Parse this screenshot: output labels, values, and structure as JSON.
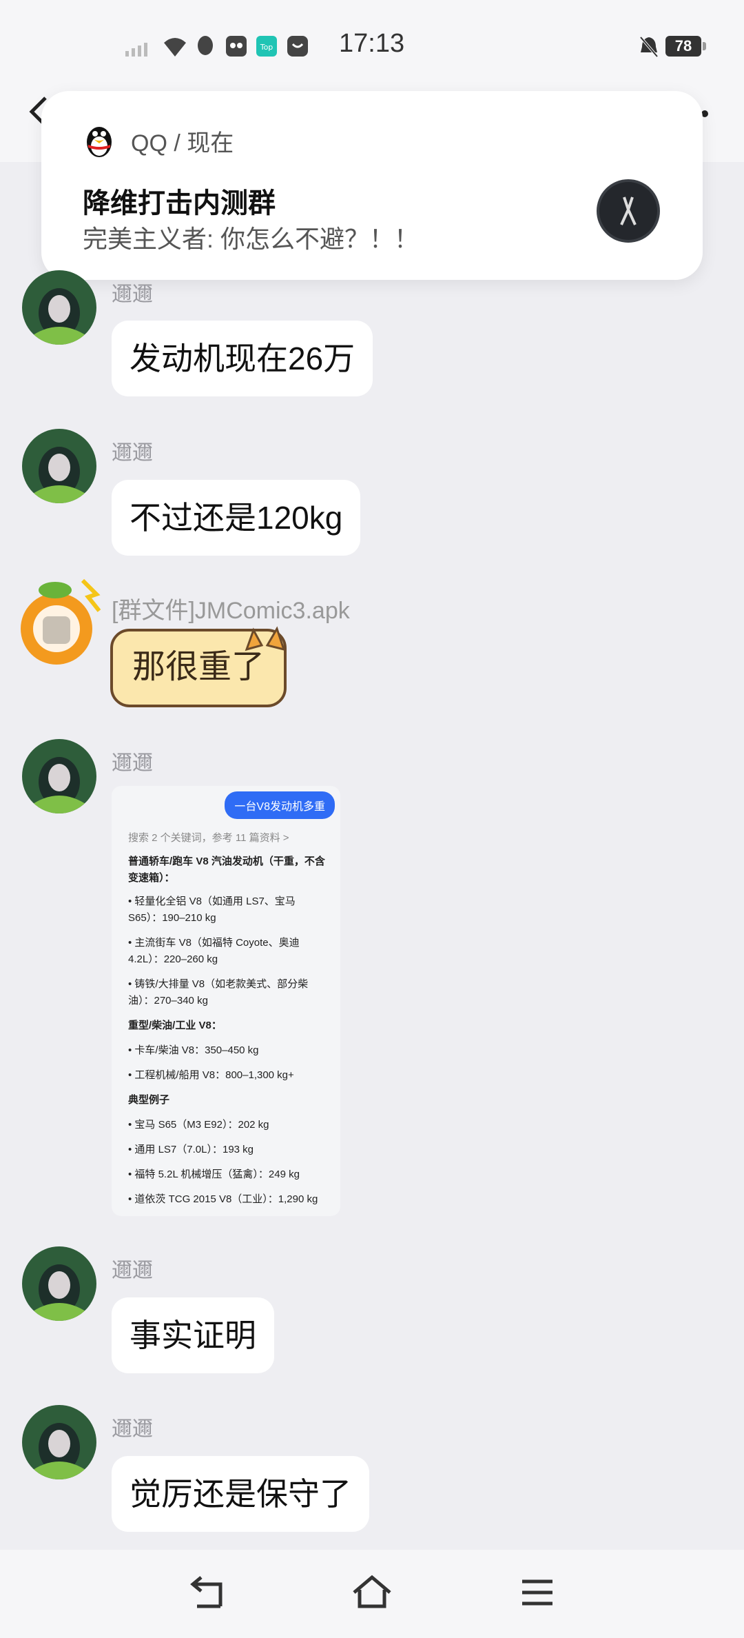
{
  "status_bar": {
    "time": "17:13",
    "battery": "78",
    "icons": [
      "signal-icon",
      "wifi-icon",
      "qq-icon",
      "app-icon",
      "top-app-icon",
      "message-app-icon",
      "mute-bell-icon",
      "battery-icon"
    ]
  },
  "notification": {
    "app": "QQ / 现在",
    "title": "降维打击内测群",
    "body": "完美主义者: 你怎么不避？！！"
  },
  "messages": [
    {
      "sender": "邇邇",
      "text": "发动机现在26万"
    },
    {
      "sender": "邇邇",
      "text": "不过还是120kg"
    },
    {
      "file": "[群文件]JMComic3.apk",
      "text": "那很重了"
    },
    {
      "sender": "邇邇"
    },
    {
      "sender": "邇邇",
      "text": "事实证明"
    },
    {
      "sender": "邇邇",
      "text": "觉厉还是保守了"
    }
  ],
  "image_message": {
    "query": "一台V8发动机多重",
    "lines": [
      "搜索 2 个关键词，参考 11 篇资料 >",
      "普通轿车/跑车 V8 汽油发动机（干重，不含",
      "变速箱）：",
      "• 轻量化全铝 V8（如通用 LS7、宝马",
      "  S65）：190–210 kg",
      "• 主流街车 V8（如福特 Coyote、奥迪",
      "  4.2L）：220–260 kg",
      "• 铸铁/大排量 V8（如老款美式、部分柴",
      "  油）：270–340 kg",
      "重型/柴油/工业 V8：",
      "• 卡车/柴油 V8：350–450 kg",
      "• 工程机械/船用 V8：800–1,300 kg+",
      "典型例子",
      "• 宝马 S65（M3 E92）：202 kg",
      "• 通用 LS7（7.0L）：193 kg",
      "• 福特 5.2L 机械增压（猛禽）：249 kg",
      "• 道依茨 TCG 2015 V8（工业）：1,290 kg"
    ]
  },
  "colors": {
    "background": "#eeeef2",
    "bubble": "#ffffff",
    "query_chip": "#2f6cf5",
    "sticker": "#fbe7ad"
  }
}
